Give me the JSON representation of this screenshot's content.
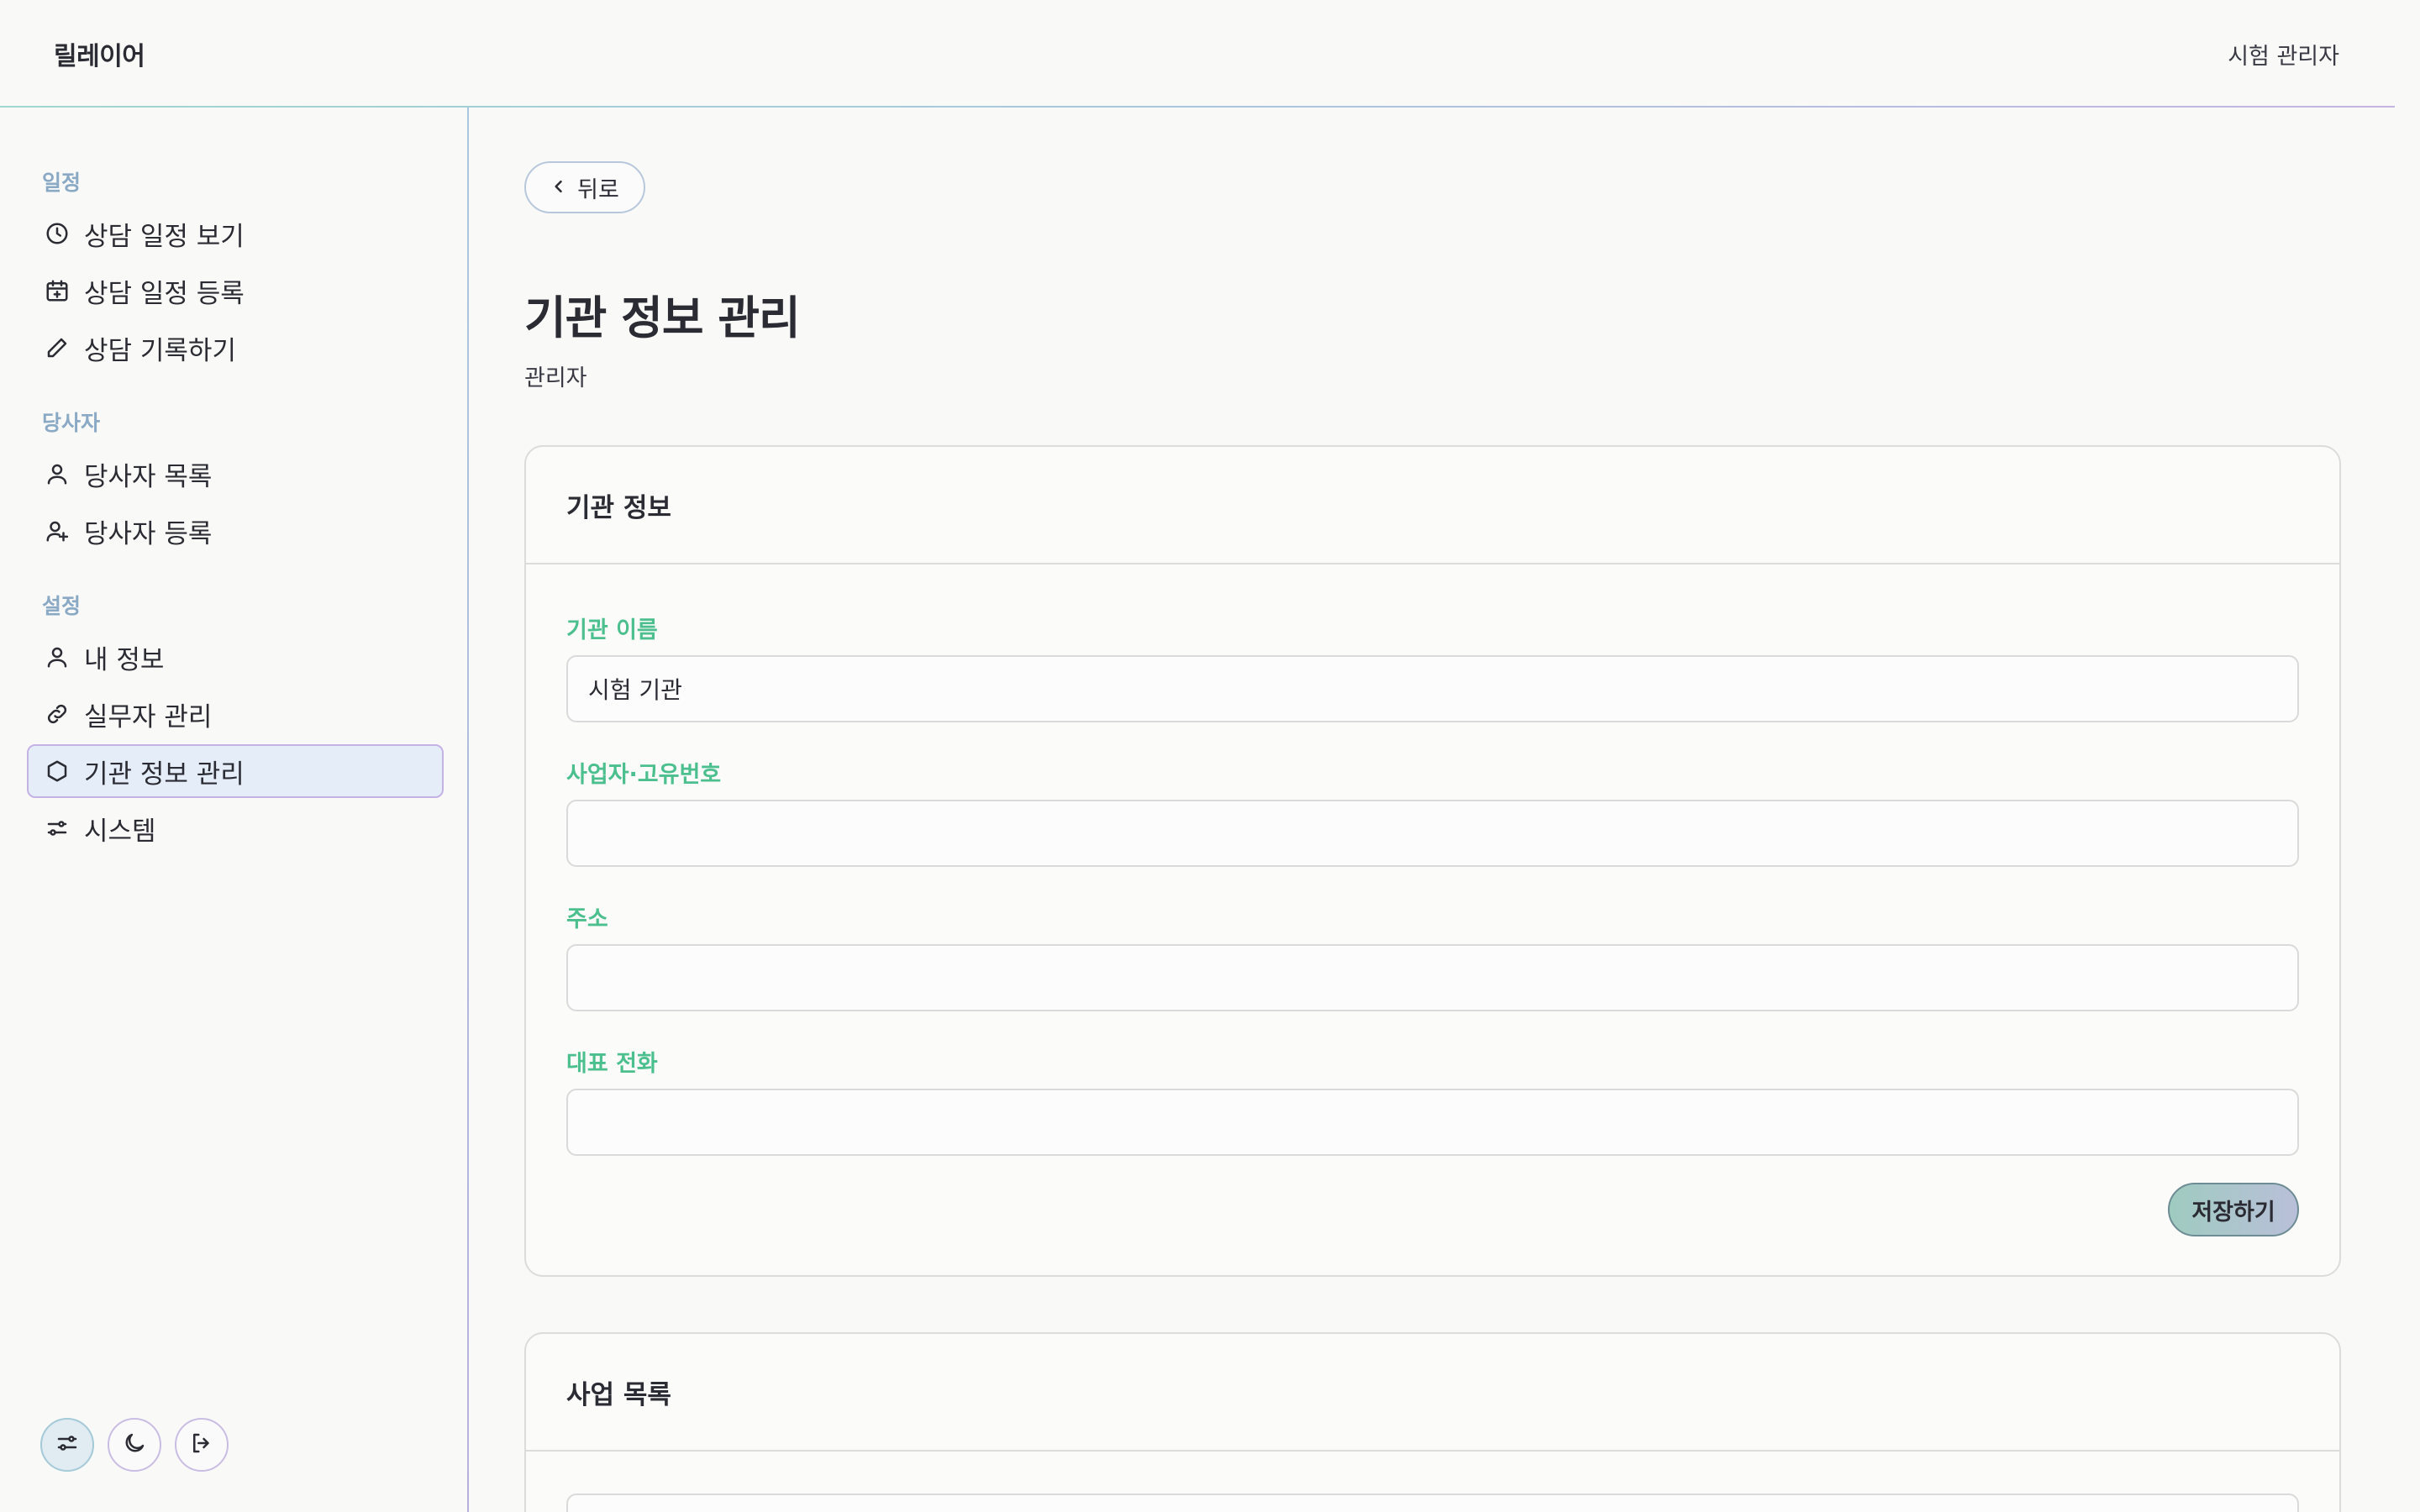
{
  "header": {
    "brand": "릴레이어",
    "user": "시험 관리자"
  },
  "sidebar": {
    "sections": [
      {
        "title": "일정",
        "items": [
          {
            "label": "상담 일정 보기",
            "icon": "clock-icon"
          },
          {
            "label": "상담 일정 등록",
            "icon": "calendar-plus-icon"
          },
          {
            "label": "상담 기록하기",
            "icon": "pencil-icon"
          }
        ]
      },
      {
        "title": "당사자",
        "items": [
          {
            "label": "당사자 목록",
            "icon": "user-icon"
          },
          {
            "label": "당사자 등록",
            "icon": "user-plus-icon"
          }
        ]
      },
      {
        "title": "설정",
        "items": [
          {
            "label": "내 정보",
            "icon": "user-icon"
          },
          {
            "label": "실무자 관리",
            "icon": "link-icon"
          },
          {
            "label": "기관 정보 관리",
            "icon": "hexagon-icon",
            "active": true
          },
          {
            "label": "시스템",
            "icon": "sliders-icon"
          }
        ]
      }
    ],
    "bottom_buttons": [
      {
        "icon": "sliders-icon",
        "active": true
      },
      {
        "icon": "moon-icon"
      },
      {
        "icon": "logout-icon"
      }
    ]
  },
  "main": {
    "back_label": "뒤로",
    "title": "기관 정보 관리",
    "subtitle": "관리자",
    "org_card": {
      "title": "기관 정보",
      "fields": [
        {
          "label": "기관 이름",
          "value": "시험 기관"
        },
        {
          "label": "사업자·고유번호",
          "value": ""
        },
        {
          "label": "주소",
          "value": ""
        },
        {
          "label": "대표 전화",
          "value": ""
        }
      ],
      "save_label": "저장하기"
    },
    "projects_card": {
      "title": "사업 목록"
    }
  },
  "colors": {
    "accent_green": "#4cbf8e",
    "section_blue": "#8aa9c5",
    "active_bg": "#e5eef8",
    "active_border": "#c5b2e4"
  }
}
